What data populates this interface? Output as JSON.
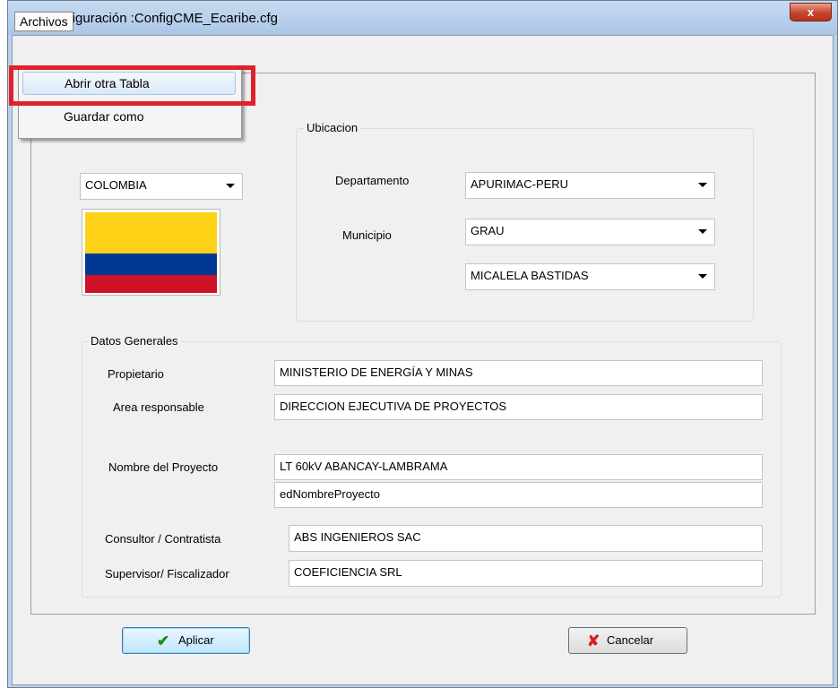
{
  "window": {
    "title": "Configuración :ConfigCME_Ecaribe.cfg",
    "close_label": "x"
  },
  "menu": {
    "archivos_label": "Archivos",
    "items": [
      {
        "label": "Abrir otra Tabla"
      },
      {
        "label": "Guardar como"
      }
    ]
  },
  "country": {
    "selected": "COLOMBIA",
    "flag_colors": [
      "#FCD116",
      "#003893",
      "#CE1126"
    ]
  },
  "ubicacion": {
    "title": "Ubicacion",
    "departamento_label": "Departamento",
    "departamento_value": "APURIMAC-PERU",
    "municipio_label": "Municipio",
    "municipio_value": "GRAU",
    "localidad_value": "MICALELA BASTIDAS"
  },
  "datos_generales": {
    "title": "Datos Generales",
    "propietario_label": "Propietario",
    "propietario_value": "MINISTERIO DE ENERGÍA Y MINAS",
    "area_label": "Area responsable",
    "area_value": "DIRECCION EJECUTIVA DE PROYECTOS",
    "nombre_label": "Nombre del Proyecto",
    "nombre_value": "LT 60kV ABANCAY-LAMBRAMA",
    "nombre_value2": "edNombreProyecto",
    "consultor_label": "Consultor / Contratista",
    "consultor_value": "ABS INGENIEROS SAC",
    "supervisor_label": "Supervisor/ Fiscalizador",
    "supervisor_value": "COEFICIENCIA SRL"
  },
  "buttons": {
    "aplicar": "Aplicar",
    "cancelar": "Cancelar"
  },
  "colors": {
    "highlight": "#e0202a",
    "check_icon": "#1f8a1f",
    "x_icon": "#d42020"
  }
}
